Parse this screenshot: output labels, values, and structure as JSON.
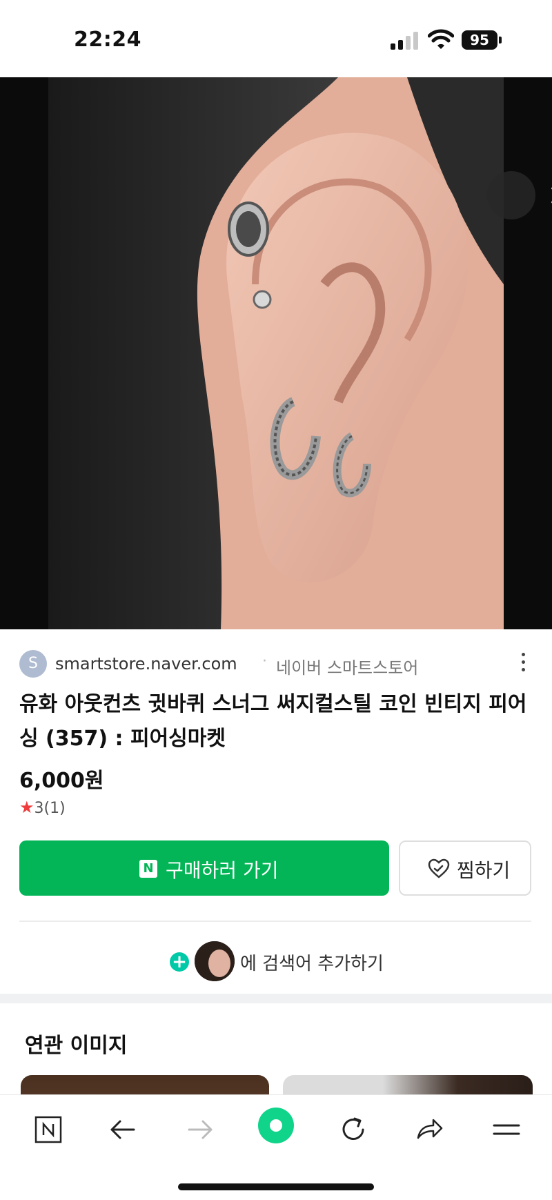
{
  "status_bar": {
    "time": "22:24",
    "battery": "95"
  },
  "source": {
    "avatar_letter": "S",
    "domain": "smartstore.naver.com",
    "separator": "·",
    "store_name": "네이버 스마트스토어"
  },
  "product": {
    "title": "유화 아웃컨츠 귓바퀴 스너그 써지컬스틸 코인 빈티지 피어싱 (357) : 피어싱마켓",
    "price": "6,000원",
    "rating_star": "★",
    "rating": "3(1)"
  },
  "actions": {
    "buy_logo": "N",
    "buy_label": "구매하러 가기",
    "wish_label": "찜하기",
    "buy_color": "#03b556"
  },
  "search_add": {
    "plus": "+",
    "label": "에 검색어 추가하기"
  },
  "related": {
    "title": "연관 이미지"
  },
  "icons": {
    "close": "close-icon",
    "lens": "image-search-icon",
    "more": "more-vertical-icon",
    "heart": "heart-icon",
    "nav": [
      "naver-home-icon",
      "back-arrow-icon",
      "forward-arrow-icon",
      "green-dot-icon",
      "refresh-icon",
      "share-icon",
      "menu-icon"
    ]
  },
  "bottom_nav": {
    "home_letter": "N"
  }
}
